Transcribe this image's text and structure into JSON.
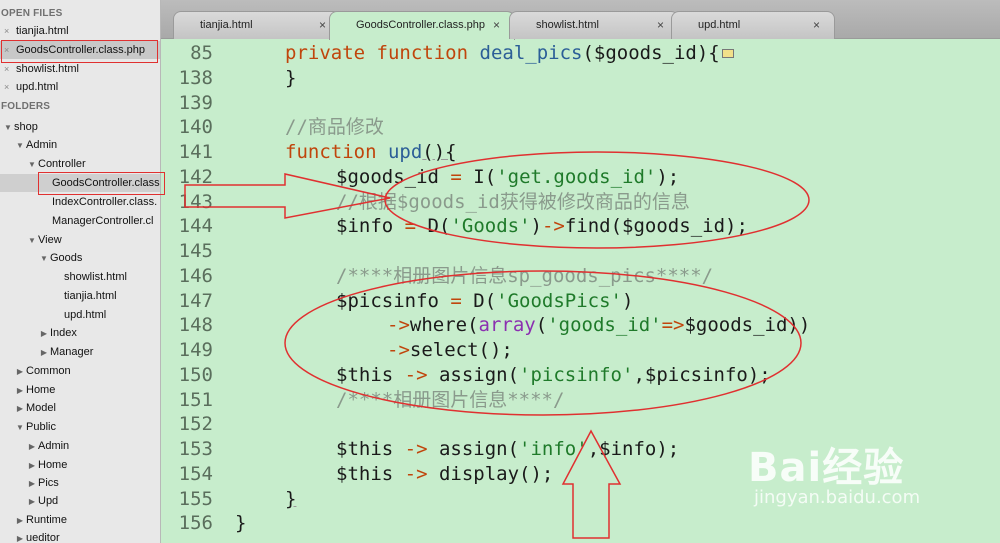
{
  "sidebar": {
    "open_files_header": "OPEN FILES",
    "folders_header": "FOLDERS",
    "open_files": [
      {
        "name": "tianjia.html"
      },
      {
        "name": "GoodsController.class.php"
      },
      {
        "name": "showlist.html"
      },
      {
        "name": "upd.html"
      }
    ],
    "close_glyph": "×",
    "tree": [
      {
        "label": "shop"
      },
      {
        "label": "Admin"
      },
      {
        "label": "Controller"
      },
      {
        "label": "GoodsController.class"
      },
      {
        "label": "IndexController.class."
      },
      {
        "label": "ManagerController.cl"
      },
      {
        "label": "View"
      },
      {
        "label": "Goods"
      },
      {
        "label": "showlist.html"
      },
      {
        "label": "tianjia.html"
      },
      {
        "label": "upd.html"
      },
      {
        "label": "Index"
      },
      {
        "label": "Manager"
      },
      {
        "label": "Common"
      },
      {
        "label": "Home"
      },
      {
        "label": "Model"
      },
      {
        "label": "Public"
      },
      {
        "label": "Admin"
      },
      {
        "label": "Home"
      },
      {
        "label": "Pics"
      },
      {
        "label": "Upd"
      },
      {
        "label": "Runtime"
      },
      {
        "label": "ueditor"
      }
    ]
  },
  "tabs": [
    {
      "label": "tianjia.html",
      "close": "×"
    },
    {
      "label": "GoodsController.class.php",
      "close": "×"
    },
    {
      "label": "showlist.html",
      "close": "×"
    },
    {
      "label": "upd.html",
      "close": "×"
    }
  ],
  "editor": {
    "line_numbers": [
      "85",
      "138",
      "139",
      "140",
      "141",
      "142",
      "143",
      "144",
      "145",
      "146",
      "147",
      "148",
      "149",
      "150",
      "151",
      "152",
      "153",
      "154",
      "155",
      "156"
    ],
    "code": {
      "l85_kw1": "private",
      "l85_kw2": "function",
      "l85_fn": "deal_pics",
      "l85_args": "($goods_id){",
      "l138": "}",
      "l140": "//商品修改",
      "l141_kw": "function",
      "l141_fn": "upd",
      "l141_rest": "(){",
      "l142_var": "$goods_id",
      "l142_eq": "=",
      "l142_fn": " I(",
      "l142_str": "'get.goods_id'",
      "l142_end": ");",
      "l143": "//根据$goods_id获得被修改商品的信息",
      "l144_var": "$info",
      "l144_eq": "=",
      "l144_a": " D(",
      "l144_str": "'Goods'",
      "l144_b": ")",
      "l144_arrow": "->",
      "l144_c": "find($goods_id);",
      "l146": "/****相册图片信息sp_goods_pics****/",
      "l147_var": "$picsinfo",
      "l147_eq": " = ",
      "l147_a": "D(",
      "l147_str": "'GoodsPics'",
      "l147_b": ")",
      "l148_arrow": "->",
      "l148_a": "where(",
      "l148_arr": "array",
      "l148_b": "(",
      "l148_str": "'goods_id'",
      "l148_op": "=>",
      "l148_c": "$goods_id))",
      "l149_arrow": "->",
      "l149_a": "select();",
      "l150_var": "$this",
      "l150_arrow": " -> ",
      "l150_a": "assign(",
      "l150_str": "'picsinfo'",
      "l150_b": ",$picsinfo);",
      "l151": "/****相册图片信息****/",
      "l153_var": "$this",
      "l153_arrow": " -> ",
      "l153_a": "assign(",
      "l153_str": "'info'",
      "l153_b": ",$info);",
      "l154_var": "$this",
      "l154_arrow": " -> ",
      "l154_a": "display();",
      "l155": "}",
      "l156": "}"
    },
    "current_line": "152"
  },
  "watermark": {
    "text": "Bai经验",
    "url": "jingyan.baidu.com"
  },
  "colors": {
    "editor_bg": "#c7edcc",
    "keyword": "#c0450c",
    "function_name": "#2b5e97",
    "string": "#1f7a2a",
    "comment": "#8a9a8c",
    "annotation": "#e03030"
  }
}
